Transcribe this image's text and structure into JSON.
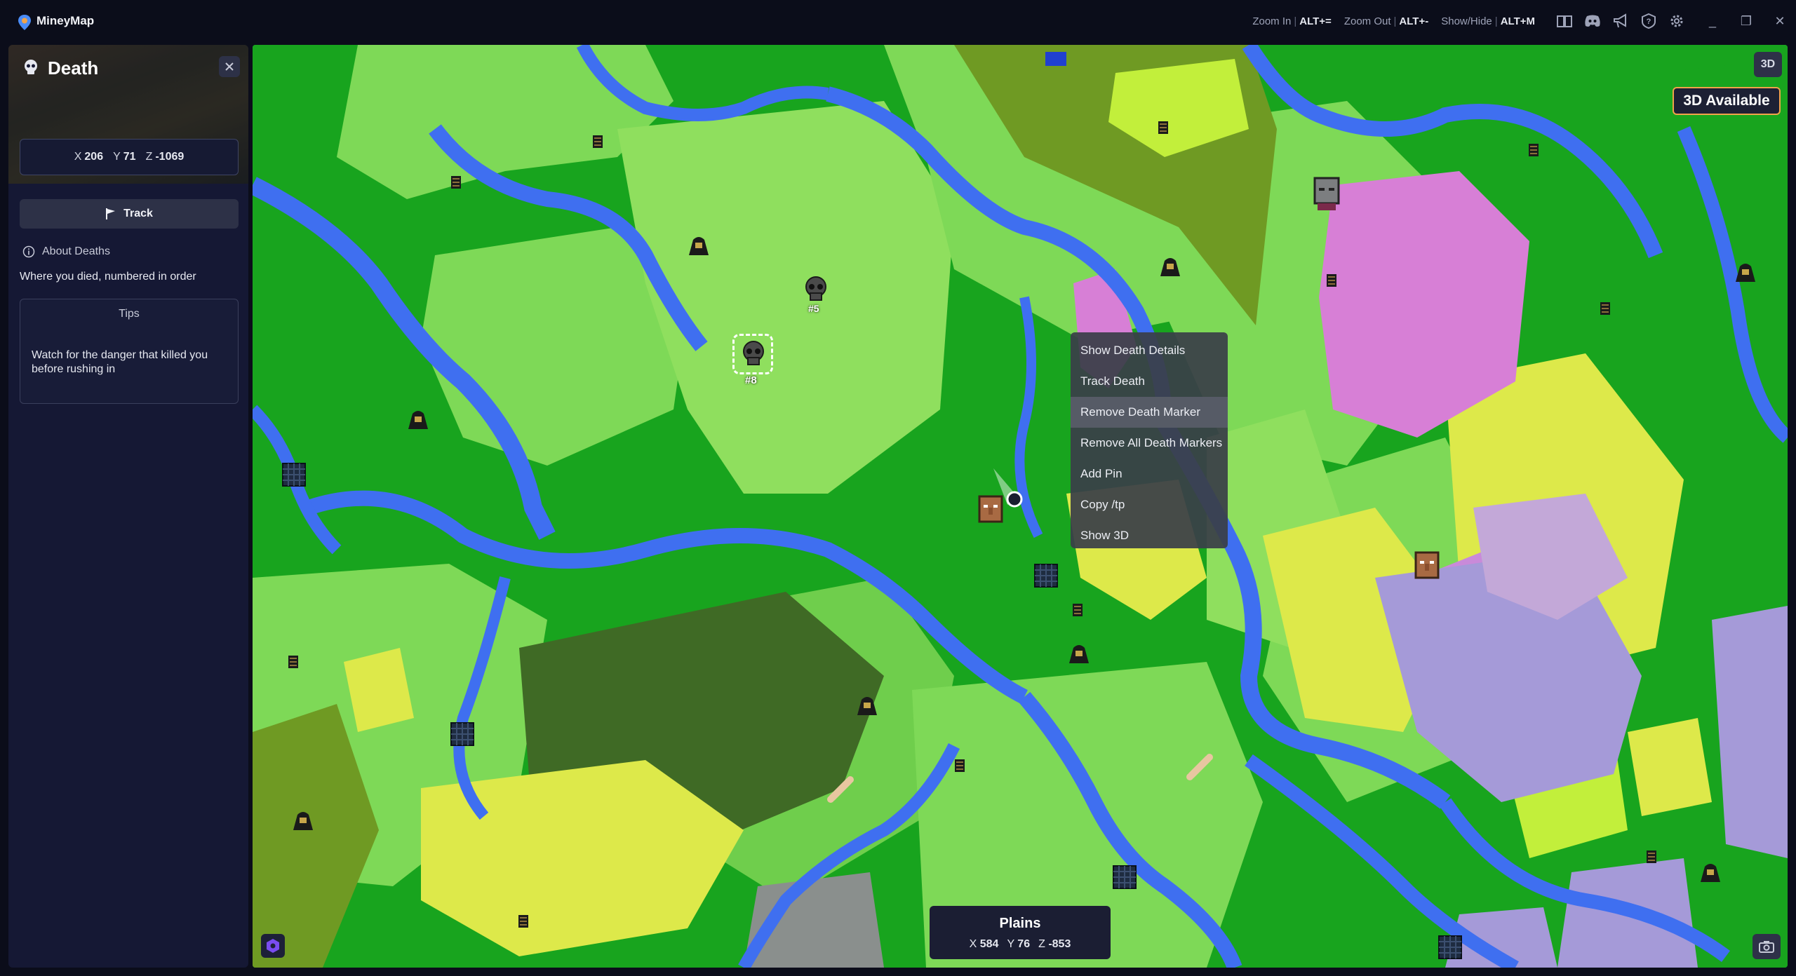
{
  "app": {
    "title": "MineyMap"
  },
  "shortcuts": [
    {
      "label": "Zoom In",
      "key": "ALT+="
    },
    {
      "label": "Zoom Out",
      "key": "ALT+-"
    },
    {
      "label": "Show/Hide",
      "key": "ALT+M"
    }
  ],
  "toolbar_icons": [
    "book-icon",
    "discord-icon",
    "megaphone-icon",
    "help-icon",
    "gear-icon"
  ],
  "window_controls": {
    "minimize": "_",
    "restore": "❐",
    "close": "✕"
  },
  "sidebar": {
    "title": "Death",
    "coords": {
      "x_label": "X",
      "x": "206",
      "y_label": "Y",
      "y": "71",
      "z_label": "Z",
      "z": "-1069"
    },
    "track_label": "Track",
    "about_label": "About Deaths",
    "about_desc": "Where you died, numbered in order",
    "tips_title": "Tips",
    "tips_text": "Watch for the danger that killed you before rushing in"
  },
  "map": {
    "btn_3d": "3D",
    "available_3d": "3D Available",
    "death_markers": [
      {
        "label": "#8",
        "selected": true
      },
      {
        "label": "#5",
        "selected": false
      }
    ],
    "context_menu": [
      {
        "label": "Show Death Details",
        "hover": false
      },
      {
        "label": "Track Death",
        "hover": false
      },
      {
        "label": "Remove Death Marker",
        "hover": true
      },
      {
        "label": "Remove All Death Markers",
        "hover": false
      },
      {
        "label": "Add Pin",
        "hover": false
      },
      {
        "label": "Copy /tp",
        "hover": false
      },
      {
        "label": "Show 3D",
        "hover": false
      }
    ],
    "biome": {
      "name": "Plains",
      "x_label": "X",
      "x": "584",
      "y_label": "Y",
      "y": "76",
      "z_label": "Z",
      "z": "-853"
    }
  },
  "colors": {
    "water": "#3f6ff0",
    "forest": "#18a41e",
    "plains": "#7ed957",
    "meadow": "#a3e84a",
    "dark_forest": "#3f6a25",
    "sunflower": "#dde94a",
    "flower_forest": "#d77fd6",
    "mountain": "#a59ad8",
    "accent_orange": "#f0a34a",
    "panel": "#151834"
  }
}
